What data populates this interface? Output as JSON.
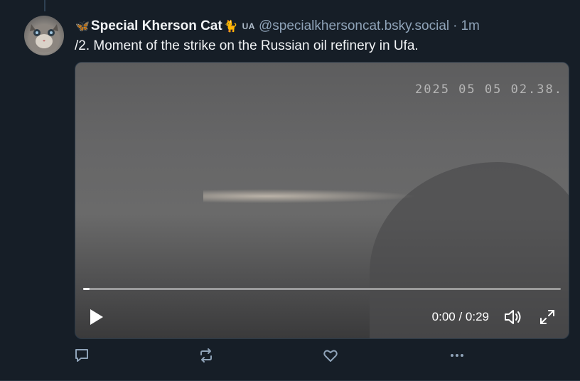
{
  "post": {
    "author_emoji": "🦋",
    "author_name": "Special Kherson Cat",
    "name_emoji": "🐈",
    "flag_text": "UA",
    "handle": "@specialkhersoncat.bsky.social",
    "separator": "·",
    "time_ago": "1m",
    "text": "/2. Moment of the strike on the Russian oil refinery in Ufa."
  },
  "video": {
    "overlay_timestamp": "2025 05 05 02.38.",
    "current_time": "0:00",
    "time_separator": " / ",
    "duration": "0:29",
    "progress_fraction": 0.013
  },
  "icons": {
    "reply": "speech-bubble-icon",
    "repost": "repost-arrows-icon",
    "like": "heart-icon",
    "more": "ellipsis-icon",
    "play": "play-icon",
    "volume": "volume-icon",
    "fullscreen": "fullscreen-icon"
  },
  "colors": {
    "background": "#161e27",
    "muted_text": "#8fa3b8",
    "icon": "#8fa3b8"
  }
}
